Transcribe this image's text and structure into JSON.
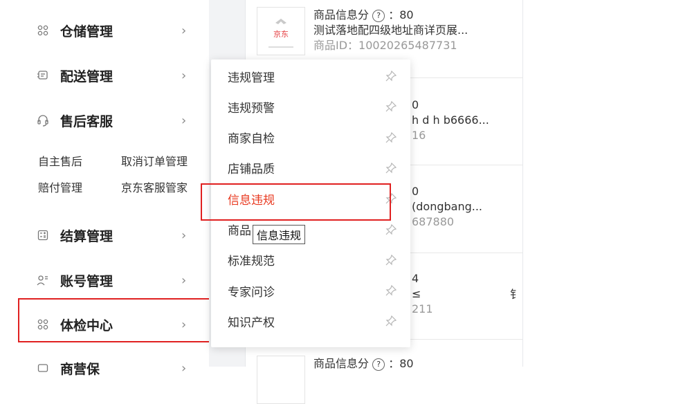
{
  "sidebar": {
    "items": [
      {
        "label": "仓储管理",
        "icon": "grid-icon"
      },
      {
        "label": "配送管理",
        "icon": "delivery-icon"
      },
      {
        "label": "售后客服",
        "icon": "headset-icon"
      },
      {
        "label": "结算管理",
        "icon": "calculator-icon"
      },
      {
        "label": "账号管理",
        "icon": "user-icon"
      },
      {
        "label": "体检中心",
        "icon": "grid-icon"
      },
      {
        "label": "商营保",
        "icon": "shield-icon"
      }
    ],
    "aftersale_links": [
      "自主售后",
      "取消订单管理",
      "赔付管理",
      "京东客服管家"
    ]
  },
  "flyout": {
    "items": [
      "违规管理",
      "违规预警",
      "商家自检",
      "店铺品质",
      "信息违规",
      "商品",
      "标准规范",
      "专家问诊",
      "知识产权"
    ],
    "active_index": 4
  },
  "tooltip": {
    "text": "信息违规"
  },
  "products": [
    {
      "score_label": "商品信息分",
      "score": "80",
      "title": "测试落地配四级地址商详页展...",
      "id": "商品ID：10020265487731",
      "thumb_text": "京东"
    },
    {
      "score_fragment": "0",
      "title_fragment": "h d h b6666...",
      "id_fragment": "16"
    },
    {
      "score_fragment": "0",
      "title_fragment": "(dongbang...",
      "id_fragment": "687880"
    },
    {
      "score_fragment": "4",
      "title_fragment": "≤",
      "id_fragment": "211",
      "extra_char": "钅"
    },
    {
      "score_label": "商品信息分",
      "score": "80"
    }
  ],
  "colors": {
    "highlight_border": "#e02020",
    "active_text": "#e8381f",
    "background_gutter": "#f2f3f5"
  }
}
